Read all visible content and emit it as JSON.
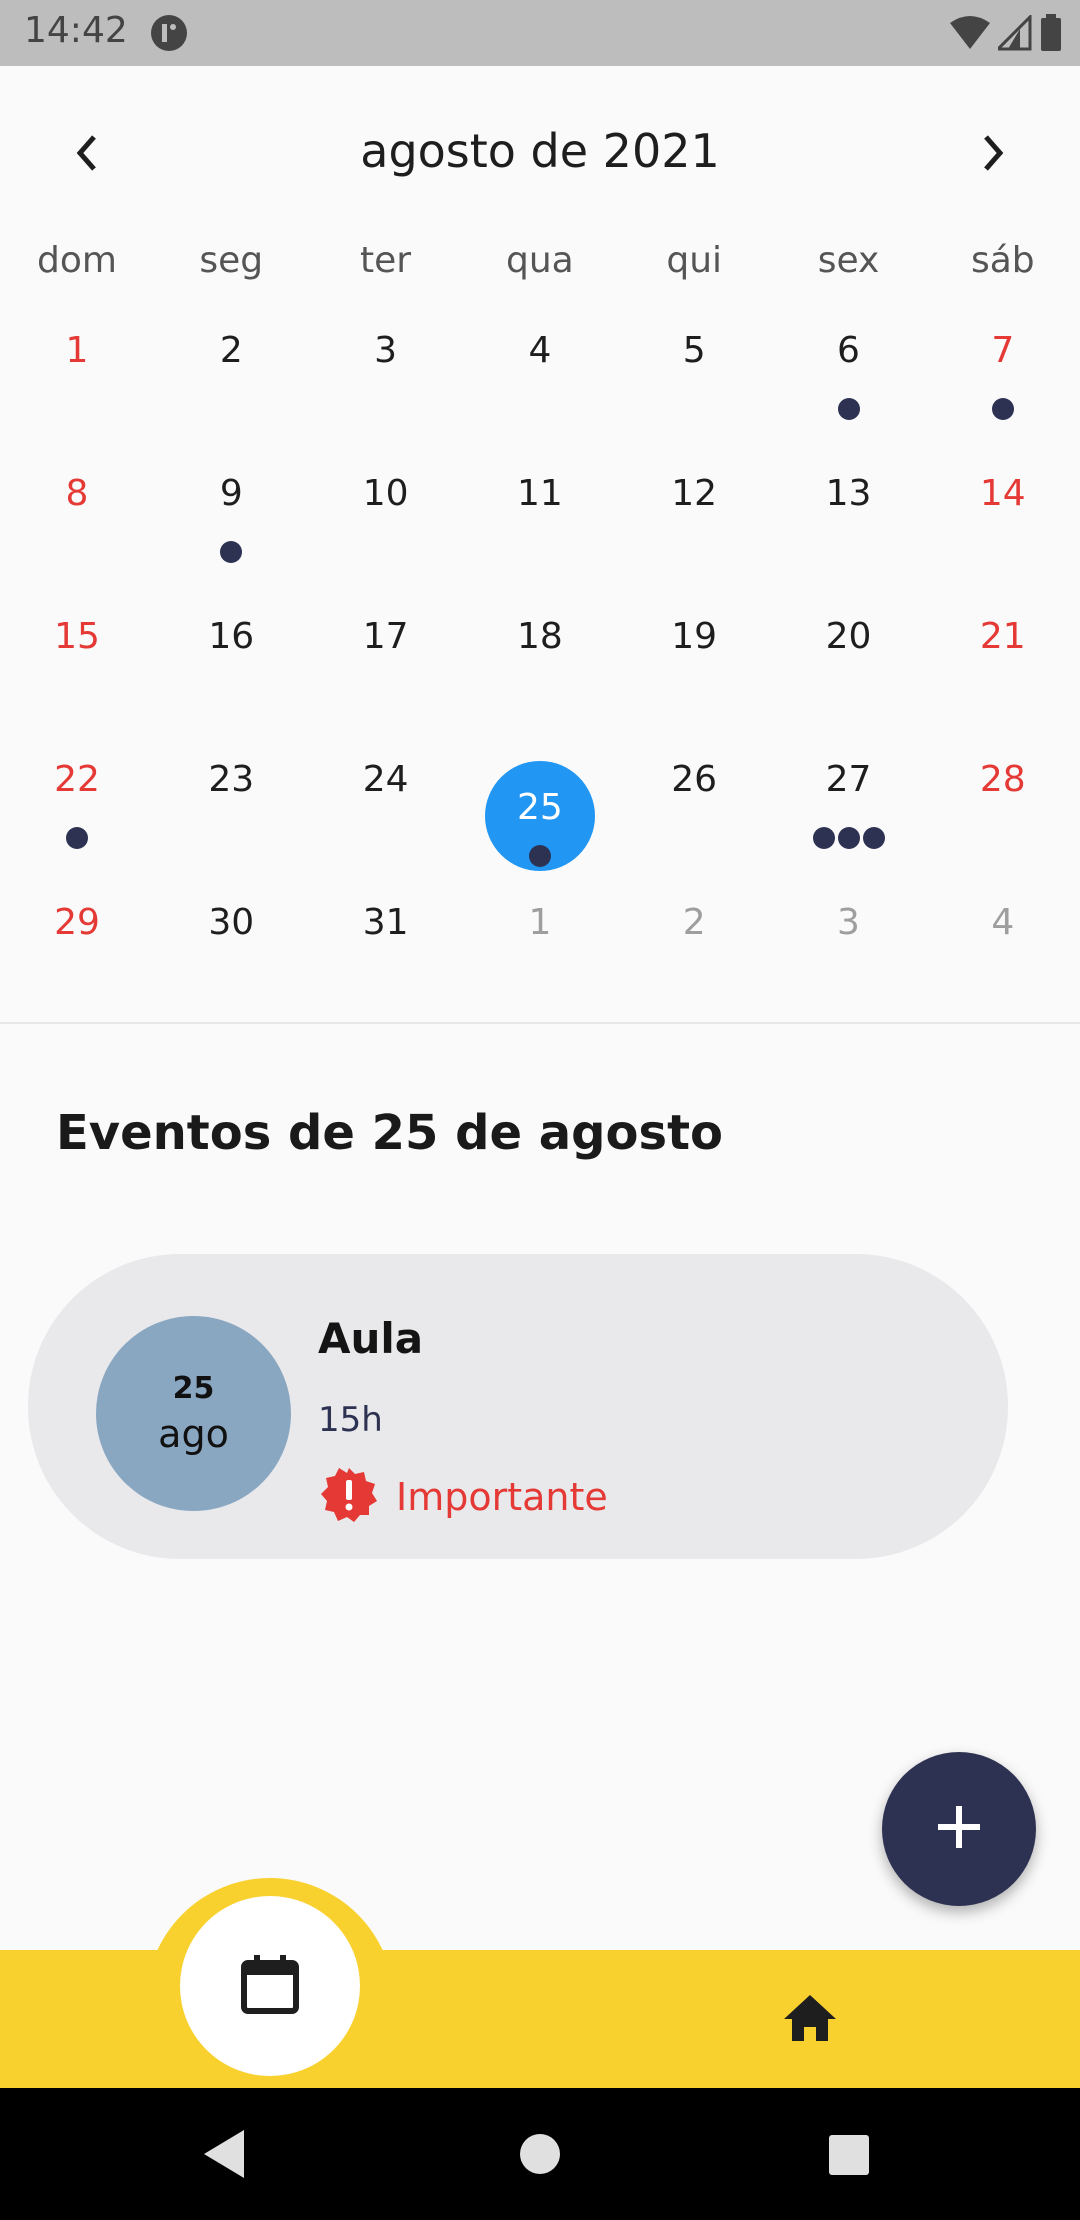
{
  "status_bar": {
    "time": "14:42",
    "icons": [
      "app-notification-icon",
      "wifi-icon",
      "cellular-signal-icon",
      "battery-icon"
    ]
  },
  "calendar": {
    "month_title": "agosto de 2021",
    "prev_icon": "chevron-left-icon",
    "next_icon": "chevron-right-icon",
    "weekdays": [
      "dom",
      "seg",
      "ter",
      "qua",
      "qui",
      "sex",
      "sáb"
    ],
    "weeks": [
      [
        {
          "d": "1",
          "weekend": true,
          "dots": 0
        },
        {
          "d": "2",
          "dots": 0
        },
        {
          "d": "3",
          "dots": 0
        },
        {
          "d": "4",
          "dots": 0
        },
        {
          "d": "5",
          "dots": 0
        },
        {
          "d": "6",
          "dots": 1
        },
        {
          "d": "7",
          "weekend": true,
          "dots": 1
        }
      ],
      [
        {
          "d": "8",
          "weekend": true,
          "dots": 0
        },
        {
          "d": "9",
          "dots": 1
        },
        {
          "d": "10",
          "dots": 0
        },
        {
          "d": "11",
          "dots": 0
        },
        {
          "d": "12",
          "dots": 0
        },
        {
          "d": "13",
          "dots": 0
        },
        {
          "d": "14",
          "weekend": true,
          "dots": 0
        }
      ],
      [
        {
          "d": "15",
          "weekend": true,
          "dots": 0
        },
        {
          "d": "16",
          "dots": 0
        },
        {
          "d": "17",
          "dots": 0
        },
        {
          "d": "18",
          "dots": 0
        },
        {
          "d": "19",
          "dots": 0
        },
        {
          "d": "20",
          "dots": 0
        },
        {
          "d": "21",
          "weekend": true,
          "dots": 0
        }
      ],
      [
        {
          "d": "22",
          "weekend": true,
          "dots": 1
        },
        {
          "d": "23",
          "dots": 0
        },
        {
          "d": "24",
          "dots": 0
        },
        {
          "d": "25",
          "dots": 1,
          "selected": true
        },
        {
          "d": "26",
          "dots": 0
        },
        {
          "d": "27",
          "dots": 3
        },
        {
          "d": "28",
          "weekend": true,
          "dots": 0
        }
      ],
      [
        {
          "d": "29",
          "weekend": true,
          "dots": 0
        },
        {
          "d": "30",
          "dots": 0
        },
        {
          "d": "31",
          "dots": 0
        },
        {
          "d": "1",
          "muted": true,
          "dots": 0
        },
        {
          "d": "2",
          "muted": true,
          "dots": 0
        },
        {
          "d": "3",
          "muted": true,
          "dots": 0
        },
        {
          "d": "4",
          "muted": true,
          "dots": 0
        }
      ]
    ]
  },
  "events": {
    "title": "Eventos de 25 de agosto",
    "items": [
      {
        "date_day": "25",
        "date_month": "ago",
        "title": "Aula",
        "time": "15h",
        "tag_label": "Importante",
        "tag_icon": "alert-badge-icon"
      }
    ]
  },
  "fab": {
    "icon": "plus-icon"
  },
  "bottom_nav": {
    "items": [
      {
        "name": "calendar",
        "icon": "calendar-icon",
        "active": true
      },
      {
        "name": "home",
        "icon": "home-icon",
        "active": false
      }
    ]
  },
  "system_nav": {
    "icons": [
      "back-icon",
      "home-circle-icon",
      "recents-icon"
    ]
  },
  "colors": {
    "accent_blue": "#2196f3",
    "navy": "#2e3252",
    "yellow": "#f9d12f",
    "weekend_red": "#e53935",
    "event_card_bg": "#e9e9ec",
    "date_circle": "#8aa7c2"
  }
}
